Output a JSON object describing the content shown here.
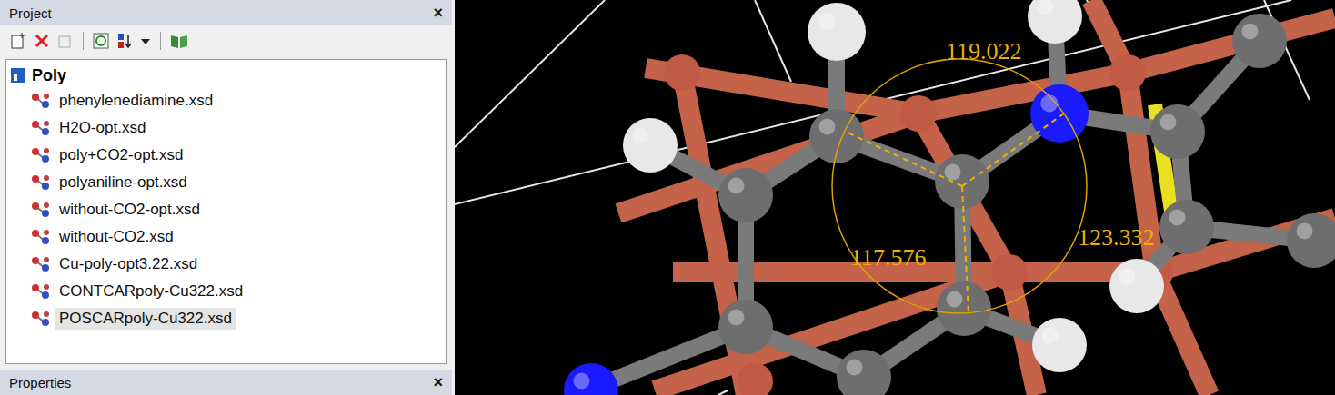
{
  "project_panel": {
    "title": "Project",
    "close": "×"
  },
  "tree": {
    "root": {
      "label": "Poly",
      "expanded": true
    },
    "items": [
      {
        "label": "phenylenediamine.xsd",
        "selected": false
      },
      {
        "label": "H2O-opt.xsd",
        "selected": false
      },
      {
        "label": "poly+CO2-opt.xsd",
        "selected": false
      },
      {
        "label": "polyaniline-opt.xsd",
        "selected": false
      },
      {
        "label": "without-CO2-opt.xsd",
        "selected": false
      },
      {
        "label": "without-CO2.xsd",
        "selected": false
      },
      {
        "label": "Cu-poly-opt3.22.xsd",
        "selected": false
      },
      {
        "label": "CONTCARpoly-Cu322.xsd",
        "selected": false
      },
      {
        "label": "POSCARpoly-Cu322.xsd",
        "selected": true
      }
    ]
  },
  "properties_panel": {
    "title": "Properties",
    "close": "×"
  },
  "viewport": {
    "angles": [
      {
        "value": "119.022"
      },
      {
        "value": "117.576"
      },
      {
        "value": "123.332"
      }
    ]
  }
}
